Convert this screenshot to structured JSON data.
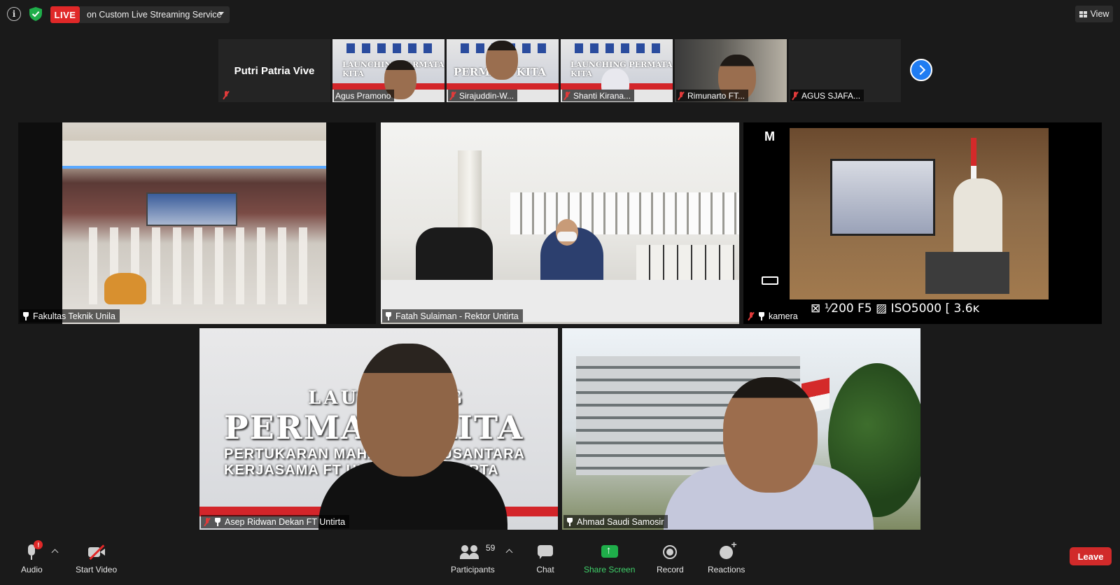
{
  "topbar": {
    "live_label": "LIVE",
    "live_service": "on Custom Live Streaming Service",
    "view_label": "View"
  },
  "filmstrip": [
    {
      "name": "Putri Patria Vive",
      "muted": true,
      "video": false
    },
    {
      "name": "Agus Pramono",
      "muted": false,
      "video": true,
      "banner": "LAUNCHING PERMATA KITA"
    },
    {
      "name": "Sirajuddin-W...",
      "muted": true,
      "video": true,
      "banner": "PERMATA KITA"
    },
    {
      "name": "Shanti Kirana...",
      "muted": true,
      "video": true,
      "banner": "LAUNCHING PERMATA KITA"
    },
    {
      "name": "Rimunarto FT...",
      "muted": true,
      "video": true
    },
    {
      "name": "AGUS SJAFA...",
      "muted": true,
      "video": false
    }
  ],
  "tiles": [
    {
      "name": "Fakultas Teknik Unila",
      "pinned": true,
      "muted": false
    },
    {
      "name": "Fatah Sulaiman - Rektor Untirta",
      "pinned": true,
      "muted": false
    },
    {
      "name": "kamera",
      "pinned": true,
      "muted": true
    },
    {
      "name": "Asep Ridwan Dekan FT Untirta",
      "pinned": true,
      "muted": true
    },
    {
      "name": "Ahmad Saudi Samosir",
      "pinned": true,
      "muted": false
    }
  ],
  "camera_overlay": {
    "mode": "M",
    "readout": "⊠  ¹⁄200   F5   ▨ ISO5000   [ 3.6ĸ"
  },
  "speaker1_banner": {
    "line1": "LAUNCHING",
    "line2": "PERMATA KITA",
    "line3": "PERTUKARAN MAHASISWA NUSANTARA",
    "line4": "KERJASAMA FT UNILA DAN UNTIRTA"
  },
  "toolbar": {
    "audio": "Audio",
    "audio_badge": "!",
    "start_video": "Start Video",
    "participants": "Participants",
    "participants_count": "59",
    "chat": "Chat",
    "share_screen": "Share Screen",
    "record": "Record",
    "reactions": "Reactions",
    "leave": "Leave"
  },
  "colors": {
    "live": "#e02828",
    "share": "#1fae4a",
    "next_button": "#1f7cf2",
    "leave": "#d12a2a"
  }
}
